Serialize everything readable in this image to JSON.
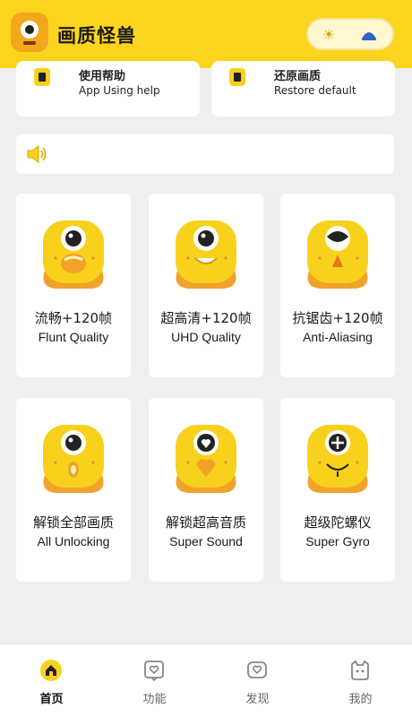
{
  "header": {
    "title": "画质怪兽"
  },
  "top_cards": [
    {
      "title_zh": "使用帮助",
      "title_en": "App Using help"
    },
    {
      "title_zh": "还原画质",
      "title_en": "Restore default"
    }
  ],
  "features": [
    {
      "title_zh": "流畅+120帧",
      "title_en": "Flunt Quality"
    },
    {
      "title_zh": "超高清+120帧",
      "title_en": "UHD Quality"
    },
    {
      "title_zh": "抗锯齿+120帧",
      "title_en": "Anti-Aliasing"
    },
    {
      "title_zh": "解锁全部画质",
      "title_en": "All Unlocking"
    },
    {
      "title_zh": "解锁超高音质",
      "title_en": "Super Sound"
    },
    {
      "title_zh": "超级陀螺仪",
      "title_en": "Super Gyro"
    }
  ],
  "bottom_nav": [
    {
      "label": "首页",
      "icon": "home-icon",
      "active": true
    },
    {
      "label": "功能",
      "icon": "function-icon",
      "active": false
    },
    {
      "label": "发现",
      "icon": "discover-icon",
      "active": false
    },
    {
      "label": "我的",
      "icon": "profile-icon",
      "active": false
    }
  ],
  "colors": {
    "brand_yellow": "#fbd51d",
    "monster_yellow": "#f8d11c",
    "monster_orange": "#f0a22a",
    "background": "#efeff1"
  }
}
